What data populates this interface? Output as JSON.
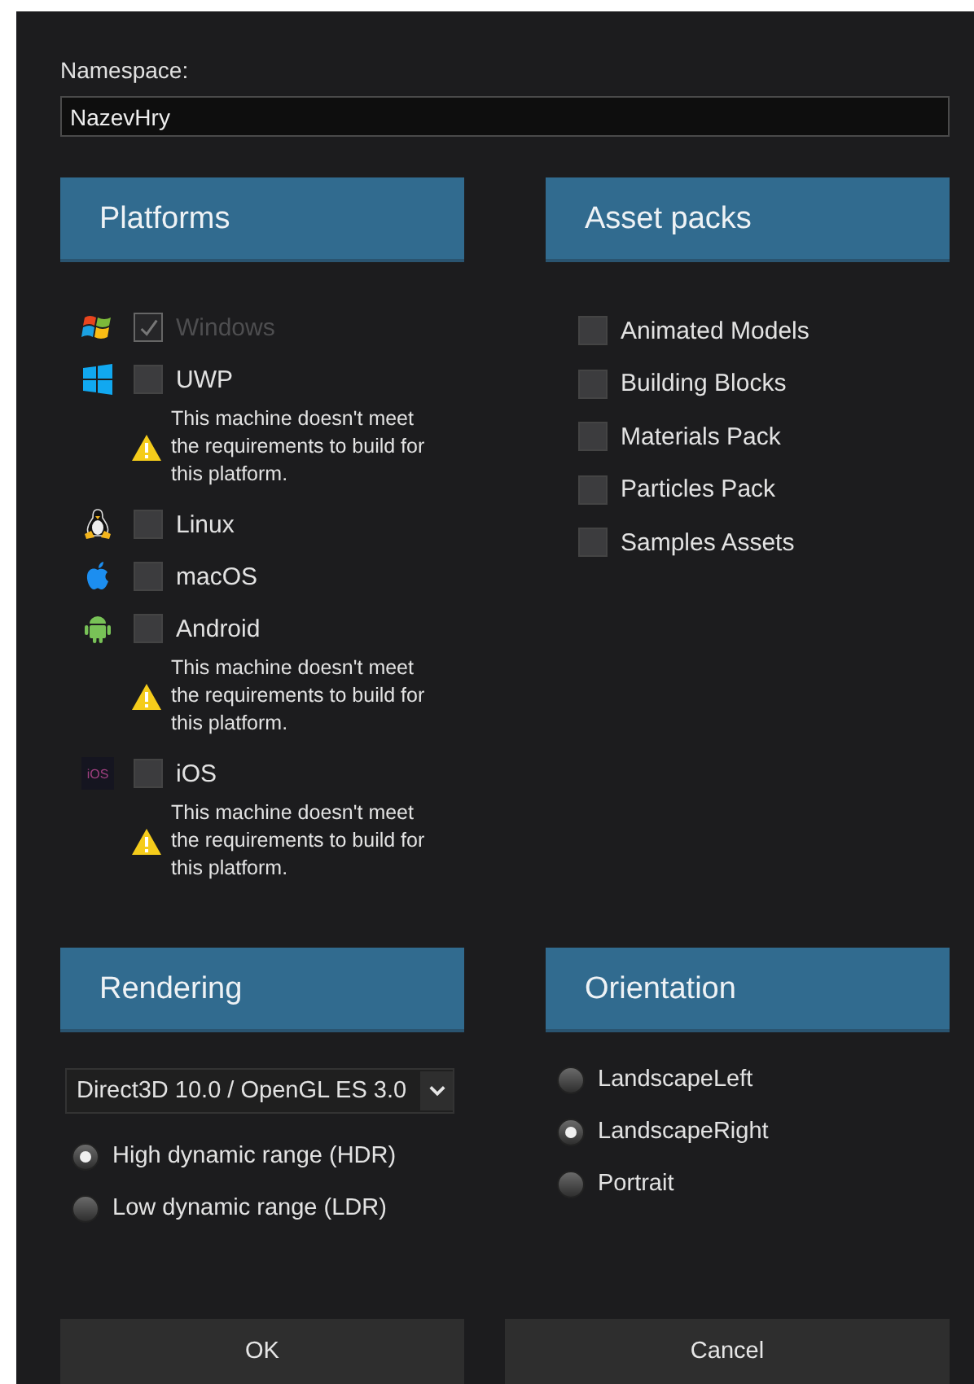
{
  "namespace": {
    "label": "Namespace:",
    "value": "NazevHry"
  },
  "platforms": {
    "title": "Platforms",
    "items": [
      {
        "kind": "windows",
        "label": "Windows",
        "checked": true,
        "disabled": true
      },
      {
        "kind": "uwp",
        "label": "UWP",
        "checked": false,
        "disabled": false,
        "warning": "This machine doesn't meet the requirements to build for this platform."
      },
      {
        "kind": "linux",
        "label": "Linux",
        "checked": false,
        "disabled": false
      },
      {
        "kind": "macos",
        "label": "macOS",
        "checked": false,
        "disabled": false
      },
      {
        "kind": "android",
        "label": "Android",
        "checked": false,
        "disabled": false,
        "warning": "This machine doesn't meet the requirements to build for this platform."
      },
      {
        "kind": "ios",
        "icon_text": "iOS",
        "label": "iOS",
        "checked": false,
        "disabled": false,
        "warning": "This machine doesn't meet the requirements to build for this platform."
      }
    ]
  },
  "asset_packs": {
    "title": "Asset packs",
    "items": [
      {
        "label": "Animated Models",
        "checked": false
      },
      {
        "label": "Building Blocks",
        "checked": false
      },
      {
        "label": "Materials Pack",
        "checked": false
      },
      {
        "label": "Particles Pack",
        "checked": false
      },
      {
        "label": "Samples Assets",
        "checked": false
      }
    ]
  },
  "rendering": {
    "title": "Rendering",
    "api": "Direct3D 10.0 / OpenGL ES 3.0",
    "options": [
      {
        "label": "High dynamic range (HDR)",
        "selected": true
      },
      {
        "label": "Low dynamic range (LDR)",
        "selected": false
      }
    ]
  },
  "orientation": {
    "title": "Orientation",
    "options": [
      {
        "label": "LandscapeLeft",
        "selected": false
      },
      {
        "label": "LandscapeRight",
        "selected": true
      },
      {
        "label": "Portrait",
        "selected": false
      }
    ]
  },
  "buttons": [
    "OK",
    "Cancel"
  ]
}
